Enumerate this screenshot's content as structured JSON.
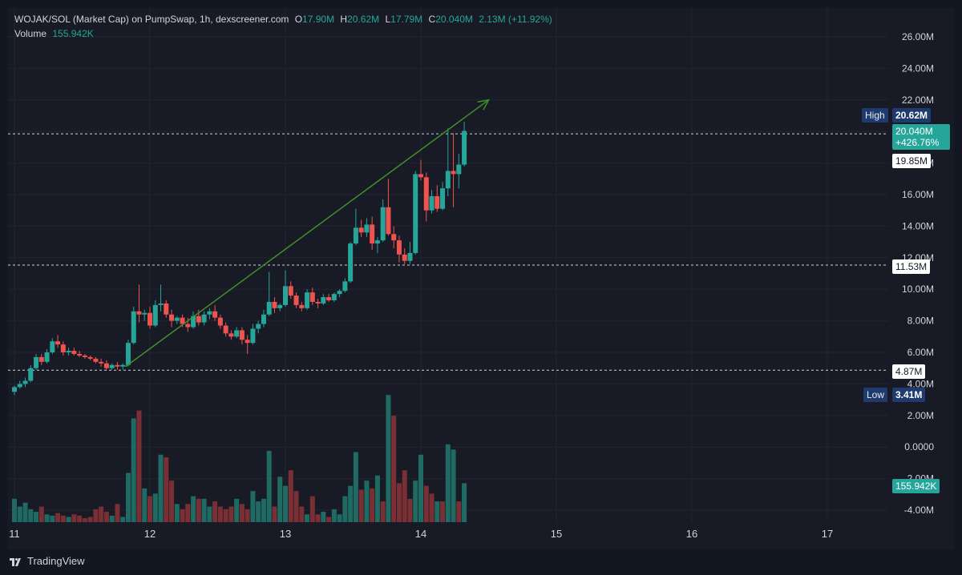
{
  "legend": {
    "symbol": "WOJAK/SOL (Market Cap) on PumpSwap, 1h, dexscreener.com",
    "o_label": "O",
    "o_value": "17.90M",
    "h_label": "H",
    "h_value": "20.62M",
    "l_label": "L",
    "l_value": "17.79M",
    "c_label": "C",
    "c_value": "20.040M",
    "change": "2.13M (+11.92%)",
    "volume_label": "Volume",
    "volume_value": "155.942K"
  },
  "tags": {
    "high_label": "High",
    "high_value": "20.62M",
    "price_value": "20.040M",
    "price_change": "+426.76%",
    "line1_value": "19.85M",
    "line2_value": "11.53M",
    "line3_value": "4.87M",
    "low_label": "Low",
    "low_value": "3.41M",
    "volume_value": "155.942K"
  },
  "footer": {
    "brand": "TradingView"
  },
  "colors": {
    "up": "#26a69a",
    "down": "#ef5350",
    "background": "#181b25",
    "trendline": "#3f8f2a"
  },
  "chart_data": {
    "type": "candlestick",
    "title": "WOJAK/SOL (Market Cap) on PumpSwap, 1h, dexscreener.com",
    "price_axis_ticks": [
      "26.00M",
      "24.00M",
      "22.00M",
      "20.00M",
      "18.00M",
      "16.00M",
      "14.00M",
      "12.00M",
      "10.00M",
      "8.00M",
      "6.00M",
      "4.00M",
      "2.00M",
      "0.0000",
      "-2.00M",
      "-4.00M"
    ],
    "time_axis_ticks": [
      "11",
      "12",
      "13",
      "14",
      "15",
      "16",
      "17"
    ],
    "time_axis_day_values": [
      11,
      12,
      13,
      14,
      15,
      16,
      17
    ],
    "ylim": [
      -4,
      26
    ],
    "price_unit": "M",
    "horizontal_lines": [
      19.85,
      11.53,
      4.87
    ],
    "high": 20.62,
    "low": 3.41,
    "trendline": {
      "from": [
        11.82,
        5.1
      ],
      "to": [
        14.5,
        22.0
      ],
      "arrow": true
    },
    "candles": [
      {
        "t": 11.0,
        "o": 3.5,
        "h": 3.9,
        "l": 3.3,
        "c": 3.8
      },
      {
        "t": 11.04,
        "o": 3.8,
        "h": 4.2,
        "l": 3.7,
        "c": 4.0
      },
      {
        "t": 11.08,
        "o": 4.0,
        "h": 4.4,
        "l": 3.8,
        "c": 4.2
      },
      {
        "t": 11.12,
        "o": 4.2,
        "h": 5.2,
        "l": 4.1,
        "c": 5.0
      },
      {
        "t": 11.16,
        "o": 5.0,
        "h": 5.9,
        "l": 4.9,
        "c": 5.7
      },
      {
        "t": 11.2,
        "o": 5.7,
        "h": 5.9,
        "l": 5.2,
        "c": 5.4
      },
      {
        "t": 11.24,
        "o": 5.4,
        "h": 6.2,
        "l": 5.3,
        "c": 6.0
      },
      {
        "t": 11.28,
        "o": 6.0,
        "h": 6.9,
        "l": 5.9,
        "c": 6.7
      },
      {
        "t": 11.32,
        "o": 6.7,
        "h": 7.1,
        "l": 6.3,
        "c": 6.5
      },
      {
        "t": 11.36,
        "o": 6.5,
        "h": 6.7,
        "l": 5.8,
        "c": 6.0
      },
      {
        "t": 11.4,
        "o": 6.0,
        "h": 6.3,
        "l": 5.8,
        "c": 6.1
      },
      {
        "t": 11.44,
        "o": 6.1,
        "h": 6.3,
        "l": 5.8,
        "c": 5.9
      },
      {
        "t": 11.48,
        "o": 5.9,
        "h": 6.1,
        "l": 5.7,
        "c": 5.8
      },
      {
        "t": 11.52,
        "o": 5.8,
        "h": 5.9,
        "l": 5.6,
        "c": 5.7
      },
      {
        "t": 11.56,
        "o": 5.7,
        "h": 5.8,
        "l": 5.5,
        "c": 5.6
      },
      {
        "t": 11.6,
        "o": 5.6,
        "h": 5.7,
        "l": 5.3,
        "c": 5.4
      },
      {
        "t": 11.64,
        "o": 5.4,
        "h": 5.6,
        "l": 5.1,
        "c": 5.3
      },
      {
        "t": 11.68,
        "o": 5.3,
        "h": 5.5,
        "l": 4.9,
        "c": 5.0
      },
      {
        "t": 11.72,
        "o": 5.0,
        "h": 5.3,
        "l": 4.9,
        "c": 5.2
      },
      {
        "t": 11.76,
        "o": 5.2,
        "h": 5.4,
        "l": 4.9,
        "c": 5.1
      },
      {
        "t": 11.8,
        "o": 5.1,
        "h": 5.3,
        "l": 4.9,
        "c": 5.2
      },
      {
        "t": 11.84,
        "o": 5.2,
        "h": 6.8,
        "l": 5.1,
        "c": 6.6
      },
      {
        "t": 11.88,
        "o": 6.6,
        "h": 8.9,
        "l": 6.5,
        "c": 8.6
      },
      {
        "t": 11.92,
        "o": 8.6,
        "h": 10.3,
        "l": 7.9,
        "c": 8.4
      },
      {
        "t": 11.96,
        "o": 8.4,
        "h": 8.7,
        "l": 8.0,
        "c": 8.5
      },
      {
        "t": 12.0,
        "o": 8.5,
        "h": 8.9,
        "l": 7.5,
        "c": 7.7
      },
      {
        "t": 12.04,
        "o": 7.7,
        "h": 9.3,
        "l": 7.6,
        "c": 9.0
      },
      {
        "t": 12.08,
        "o": 9.0,
        "h": 10.3,
        "l": 8.6,
        "c": 9.1
      },
      {
        "t": 12.12,
        "o": 9.1,
        "h": 9.3,
        "l": 8.2,
        "c": 8.4
      },
      {
        "t": 12.16,
        "o": 8.4,
        "h": 8.7,
        "l": 7.6,
        "c": 8.0
      },
      {
        "t": 12.2,
        "o": 8.0,
        "h": 8.3,
        "l": 7.8,
        "c": 8.2
      },
      {
        "t": 12.24,
        "o": 8.2,
        "h": 8.4,
        "l": 7.6,
        "c": 7.8
      },
      {
        "t": 12.28,
        "o": 7.8,
        "h": 8.2,
        "l": 7.3,
        "c": 7.6
      },
      {
        "t": 12.32,
        "o": 7.6,
        "h": 8.6,
        "l": 7.5,
        "c": 8.3
      },
      {
        "t": 12.36,
        "o": 8.3,
        "h": 8.7,
        "l": 7.7,
        "c": 7.9
      },
      {
        "t": 12.4,
        "o": 7.9,
        "h": 8.6,
        "l": 7.7,
        "c": 8.4
      },
      {
        "t": 12.44,
        "o": 8.4,
        "h": 8.8,
        "l": 8.1,
        "c": 8.6
      },
      {
        "t": 12.48,
        "o": 8.6,
        "h": 9.0,
        "l": 8.0,
        "c": 8.2
      },
      {
        "t": 12.52,
        "o": 8.2,
        "h": 8.4,
        "l": 7.5,
        "c": 7.7
      },
      {
        "t": 12.56,
        "o": 7.7,
        "h": 7.9,
        "l": 7.0,
        "c": 7.2
      },
      {
        "t": 12.6,
        "o": 7.2,
        "h": 7.4,
        "l": 6.8,
        "c": 7.0
      },
      {
        "t": 12.64,
        "o": 7.0,
        "h": 7.6,
        "l": 6.9,
        "c": 7.4
      },
      {
        "t": 12.68,
        "o": 7.4,
        "h": 7.6,
        "l": 6.5,
        "c": 6.8
      },
      {
        "t": 12.72,
        "o": 6.8,
        "h": 7.1,
        "l": 5.9,
        "c": 6.6
      },
      {
        "t": 12.76,
        "o": 6.6,
        "h": 7.8,
        "l": 6.5,
        "c": 7.5
      },
      {
        "t": 12.8,
        "o": 7.5,
        "h": 8.0,
        "l": 7.2,
        "c": 7.8
      },
      {
        "t": 12.84,
        "o": 7.8,
        "h": 8.7,
        "l": 7.6,
        "c": 8.4
      },
      {
        "t": 12.88,
        "o": 8.4,
        "h": 11.1,
        "l": 8.3,
        "c": 9.2
      },
      {
        "t": 12.92,
        "o": 9.2,
        "h": 9.5,
        "l": 8.5,
        "c": 8.8
      },
      {
        "t": 12.96,
        "o": 8.8,
        "h": 9.1,
        "l": 8.6,
        "c": 9.0
      },
      {
        "t": 13.0,
        "o": 9.0,
        "h": 11.2,
        "l": 8.9,
        "c": 10.2
      },
      {
        "t": 13.04,
        "o": 10.2,
        "h": 10.5,
        "l": 9.4,
        "c": 9.6
      },
      {
        "t": 13.08,
        "o": 9.6,
        "h": 9.8,
        "l": 8.8,
        "c": 9.0
      },
      {
        "t": 13.12,
        "o": 9.0,
        "h": 9.2,
        "l": 8.6,
        "c": 8.8
      },
      {
        "t": 13.16,
        "o": 8.8,
        "h": 10.0,
        "l": 8.7,
        "c": 9.8
      },
      {
        "t": 13.2,
        "o": 9.8,
        "h": 10.1,
        "l": 9.0,
        "c": 9.2
      },
      {
        "t": 13.24,
        "o": 9.2,
        "h": 9.4,
        "l": 8.8,
        "c": 9.1
      },
      {
        "t": 13.28,
        "o": 9.1,
        "h": 9.7,
        "l": 9.0,
        "c": 9.5
      },
      {
        "t": 13.32,
        "o": 9.5,
        "h": 9.7,
        "l": 9.2,
        "c": 9.3
      },
      {
        "t": 13.36,
        "o": 9.3,
        "h": 9.8,
        "l": 9.2,
        "c": 9.7
      },
      {
        "t": 13.4,
        "o": 9.7,
        "h": 10.0,
        "l": 9.5,
        "c": 9.9
      },
      {
        "t": 13.44,
        "o": 9.9,
        "h": 10.7,
        "l": 9.8,
        "c": 10.5
      },
      {
        "t": 13.48,
        "o": 10.5,
        "h": 13.0,
        "l": 10.4,
        "c": 12.9
      },
      {
        "t": 13.52,
        "o": 12.9,
        "h": 15.1,
        "l": 12.8,
        "c": 13.9
      },
      {
        "t": 13.56,
        "o": 13.9,
        "h": 14.4,
        "l": 13.3,
        "c": 13.6
      },
      {
        "t": 13.6,
        "o": 13.6,
        "h": 14.5,
        "l": 13.3,
        "c": 14.1
      },
      {
        "t": 13.64,
        "o": 14.1,
        "h": 14.6,
        "l": 12.5,
        "c": 12.9
      },
      {
        "t": 13.68,
        "o": 12.9,
        "h": 13.3,
        "l": 12.3,
        "c": 13.1
      },
      {
        "t": 13.72,
        "o": 13.1,
        "h": 15.7,
        "l": 13.0,
        "c": 15.2
      },
      {
        "t": 13.76,
        "o": 15.2,
        "h": 17.0,
        "l": 13.4,
        "c": 13.5
      },
      {
        "t": 13.8,
        "o": 13.5,
        "h": 14.0,
        "l": 12.6,
        "c": 13.1
      },
      {
        "t": 13.84,
        "o": 13.1,
        "h": 13.4,
        "l": 11.7,
        "c": 12.2
      },
      {
        "t": 13.88,
        "o": 12.2,
        "h": 12.6,
        "l": 11.6,
        "c": 11.8
      },
      {
        "t": 13.92,
        "o": 11.8,
        "h": 13.0,
        "l": 11.6,
        "c": 12.3
      },
      {
        "t": 13.96,
        "o": 12.3,
        "h": 17.5,
        "l": 12.2,
        "c": 17.3
      },
      {
        "t": 14.0,
        "o": 17.3,
        "h": 18.2,
        "l": 16.9,
        "c": 17.1
      },
      {
        "t": 14.04,
        "o": 17.1,
        "h": 17.4,
        "l": 14.3,
        "c": 15.0
      },
      {
        "t": 14.08,
        "o": 15.0,
        "h": 16.3,
        "l": 14.8,
        "c": 15.9
      },
      {
        "t": 14.12,
        "o": 15.9,
        "h": 16.6,
        "l": 14.9,
        "c": 15.1
      },
      {
        "t": 14.16,
        "o": 15.1,
        "h": 16.8,
        "l": 15.0,
        "c": 16.4
      },
      {
        "t": 14.2,
        "o": 16.4,
        "h": 20.2,
        "l": 15.9,
        "c": 17.5
      },
      {
        "t": 14.24,
        "o": 17.5,
        "h": 19.9,
        "l": 15.2,
        "c": 17.3
      },
      {
        "t": 14.28,
        "o": 17.3,
        "h": 18.6,
        "l": 16.4,
        "c": 17.9
      },
      {
        "t": 14.32,
        "o": 17.9,
        "h": 20.62,
        "l": 17.79,
        "c": 20.04
      }
    ],
    "volume_relative": [
      0.18,
      0.12,
      0.15,
      0.1,
      0.08,
      0.12,
      0.06,
      0.05,
      0.07,
      0.05,
      0.04,
      0.06,
      0.05,
      0.03,
      0.04,
      0.1,
      0.12,
      0.08,
      0.05,
      0.14,
      0.04,
      0.38,
      0.8,
      0.86,
      0.26,
      0.2,
      0.22,
      0.52,
      0.5,
      0.32,
      0.14,
      0.1,
      0.14,
      0.2,
      0.18,
      0.18,
      0.12,
      0.16,
      0.12,
      0.1,
      0.12,
      0.18,
      0.14,
      0.1,
      0.24,
      0.16,
      0.18,
      0.55,
      0.12,
      0.35,
      0.28,
      0.4,
      0.24,
      0.12,
      0.06,
      0.2,
      0.06,
      0.08,
      0.04,
      0.1,
      0.06,
      0.2,
      0.28,
      0.54,
      0.25,
      0.32,
      0.26,
      0.36,
      0.16,
      0.98,
      0.82,
      0.3,
      0.4,
      0.18,
      0.32,
      0.52,
      0.28,
      0.22,
      0.16,
      0.16,
      0.6,
      0.56,
      0.16,
      0.3
    ],
    "volume_up": [
      true,
      true,
      true,
      true,
      true,
      false,
      true,
      true,
      false,
      false,
      true,
      false,
      false,
      false,
      false,
      false,
      false,
      false,
      true,
      false,
      true,
      true,
      true,
      false,
      true,
      false,
      true,
      true,
      false,
      false,
      true,
      false,
      false,
      true,
      false,
      true,
      true,
      false,
      false,
      false,
      false,
      true,
      false,
      false,
      true,
      true,
      true,
      true,
      false,
      true,
      true,
      false,
      false,
      false,
      true,
      false,
      false,
      true,
      false,
      true,
      true,
      true,
      true,
      true,
      false,
      true,
      false,
      true,
      false,
      true,
      false,
      false,
      false,
      false,
      true,
      true,
      false,
      false,
      true,
      false,
      true,
      true,
      false,
      true
    ]
  }
}
